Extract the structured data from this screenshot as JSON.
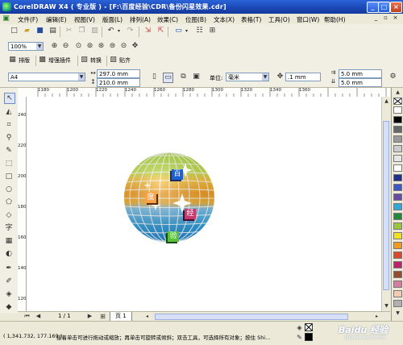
{
  "window": {
    "title": "CorelDRAW X4 ( 专业版 ) - [F:\\百度经验\\CDR\\备份闪星效果.cdr]",
    "minimize": "_",
    "maximize": "□",
    "close": "×"
  },
  "menu": {
    "items": [
      "文件(F)",
      "编辑(E)",
      "视图(V)",
      "版面(L)",
      "排列(A)",
      "效果(C)",
      "位图(B)",
      "文本(X)",
      "表格(T)",
      "工具(O)",
      "窗口(W)",
      "帮助(H)"
    ],
    "doc_min": "_",
    "doc_restore": "▫",
    "doc_close": "×"
  },
  "toolbar_zoom": {
    "zoom_value": "100%"
  },
  "toolbar_plugins": {
    "items": [
      "排版",
      "增强插件",
      "转换",
      "贴齐"
    ]
  },
  "property_bar": {
    "paper_size": "A4",
    "width": "297.0 mm",
    "height": "210.0 mm",
    "unit_label": "单位:",
    "unit_value": "毫米",
    "nudge": ".1 mm",
    "dup_x": "5.0 mm",
    "dup_y": "5.0 mm"
  },
  "ruler": {
    "h_ticks": [
      "1180",
      "1200",
      "1220",
      "1240",
      "1260",
      "1280",
      "1300",
      "1320",
      "1340",
      "1360"
    ],
    "v_ticks": [
      "240",
      "220",
      "200",
      "180",
      "160",
      "140",
      "120"
    ]
  },
  "artwork": {
    "chars": [
      "百",
      "度",
      "经",
      "验"
    ],
    "chars_colors": [
      "#1f5fd0",
      "#d87a2a",
      "#c83a6e",
      "#3a9a3a"
    ]
  },
  "page_tabs": {
    "page_counter": "1 / 1",
    "tab_label": "页 1"
  },
  "status": {
    "coords": "( 1,341.732, 177.169 )",
    "message": "接着单击可进行拖动或缩放；再单击可旋转或倾斜；双击工具，可选择所有对象；按住 Shi...",
    "watermark": "Baidu 经验",
    "watermark_url": "jingyan.baidu.com"
  },
  "palette_colors": [
    "#ffffff",
    "#000000",
    "#666666",
    "#999999",
    "#cccccc",
    "#e6e6e6",
    "#ffffff",
    "#1f2f8f",
    "#3c57c8",
    "#6a4aa8",
    "#2fa7d8",
    "#1f8a3a",
    "#98c837",
    "#f4e11a",
    "#f39a1c",
    "#e2442a",
    "#c01f6a",
    "#9a4a2a",
    "#d97aa0",
    "#f7c9b0",
    "#b0b0b0"
  ]
}
